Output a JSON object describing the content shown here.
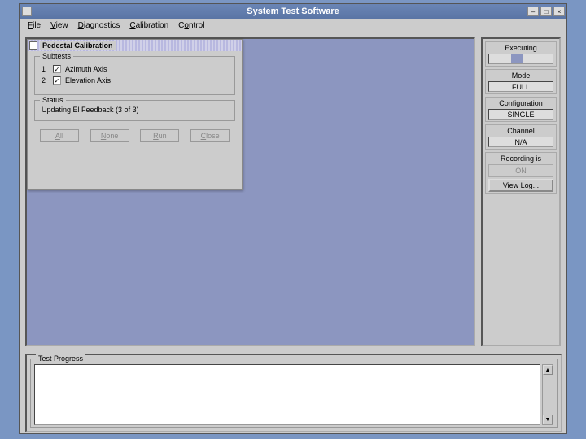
{
  "window": {
    "title": "System Test Software",
    "menubar": [
      {
        "label": "File",
        "ul": "F"
      },
      {
        "label": "View",
        "ul": "V"
      },
      {
        "label": "Diagnostics",
        "ul": "D"
      },
      {
        "label": "Calibration",
        "ul": "C"
      },
      {
        "label": "Control",
        "ul": "o"
      }
    ]
  },
  "dialog": {
    "title": "Pedestal Calibration",
    "subtests_legend": "Subtests",
    "subtests": [
      {
        "num": "1",
        "checked": true,
        "label": "Azimuth Axis"
      },
      {
        "num": "2",
        "checked": true,
        "label": "Elevation Axis"
      }
    ],
    "status_legend": "Status",
    "status_text": "Updating El Feedback (3 of 3)",
    "buttons": [
      {
        "label": "All",
        "ul": "A"
      },
      {
        "label": "None",
        "ul": "N"
      },
      {
        "label": "Run",
        "ul": "R"
      },
      {
        "label": "Close",
        "ul": "C"
      }
    ]
  },
  "sidebar": {
    "executing_label": "Executing",
    "mode_label": "Mode",
    "mode_value": "FULL",
    "config_label": "Configuration",
    "config_value": "SINGLE",
    "channel_label": "Channel",
    "channel_value": "N/A",
    "recording_label": "Recording is",
    "recording_value": "ON",
    "viewlog_label": "View Log..."
  },
  "bottom": {
    "legend": "Test Progress"
  }
}
